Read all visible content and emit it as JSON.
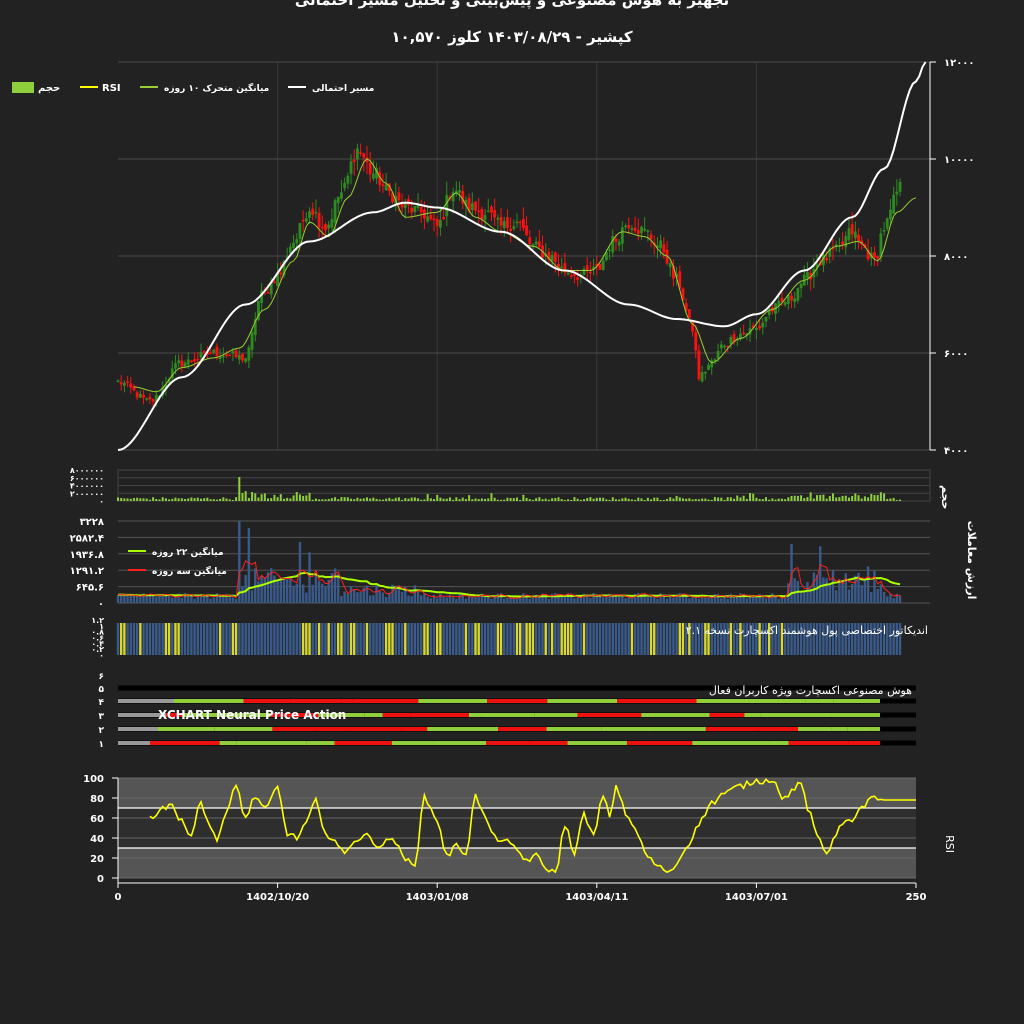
{
  "title_line1": "تجهیز به هوش مصنوعی و پیش‌بینی و تحلیل مسیر احتمالی",
  "title_line2": "کپشیر - ۱۴۰۳/۰۸/۲۹ کلوز ۱۰,۵۷۰",
  "colors": {
    "background": "#222222",
    "up": "#2e8b22",
    "down": "#ff1010",
    "ma10": "#9acd32",
    "path": "#ffffff",
    "rsi": "#ffff00",
    "volume": "#8fcf3c",
    "value_bar": "#3a5a8a",
    "ma22": "#aaff00",
    "ma3": "#ff2020"
  },
  "panels": {
    "volume_label": "حجم",
    "value_label": "ارزش معاملات",
    "value_legend": [
      "میانگین ۲۲ روزه",
      "میانگین سه روزه"
    ],
    "indicator_label": "اندیکاتور اختصاصی پول هوشمند اکسچارت نسخه ۲.۱",
    "ai_label": "هوش مصنوعی اکسچارت ویژه کاربران فعال",
    "ai_watermark": "XCHART Neural Price Action",
    "rsi_label": "RSI"
  },
  "chart_data": [
    {
      "type": "candlestick",
      "title": "کپشیر",
      "legend": [
        {
          "name": "حجم",
          "kind": "box",
          "color": "#8fcf3c"
        },
        {
          "name": "RSI",
          "kind": "line",
          "color": "#ffff00"
        },
        {
          "name": "میانگین متحرک ۱۰ روزه",
          "kind": "line",
          "color": "#9acd32"
        },
        {
          "name": "مسیر احتمالی",
          "kind": "line",
          "color": "#ffffff"
        }
      ],
      "ylim": [
        4000,
        12000
      ],
      "yticks": [
        "۴۰۰۰",
        "۶۰۰۰",
        "۸۰۰۰",
        "۱۰۰۰۰",
        "۱۲۰۰۰"
      ],
      "close_anchors": [
        [
          0,
          5400
        ],
        [
          10,
          5000
        ],
        [
          20,
          5800
        ],
        [
          30,
          6000
        ],
        [
          40,
          5900
        ],
        [
          45,
          7200
        ],
        [
          50,
          7600
        ],
        [
          55,
          8300
        ],
        [
          60,
          9000
        ],
        [
          65,
          8600
        ],
        [
          70,
          9300
        ],
        [
          75,
          10200
        ],
        [
          80,
          9700
        ],
        [
          85,
          9300
        ],
        [
          90,
          9000
        ],
        [
          95,
          8900
        ],
        [
          100,
          8600
        ],
        [
          105,
          9400
        ],
        [
          110,
          9000
        ],
        [
          115,
          8900
        ],
        [
          120,
          8600
        ],
        [
          125,
          8700
        ],
        [
          130,
          8200
        ],
        [
          135,
          8000
        ],
        [
          140,
          7700
        ],
        [
          145,
          7600
        ],
        [
          150,
          7700
        ],
        [
          155,
          8300
        ],
        [
          160,
          8700
        ],
        [
          165,
          8500
        ],
        [
          170,
          8200
        ],
        [
          175,
          7500
        ],
        [
          180,
          6500
        ],
        [
          182,
          5500
        ],
        [
          186,
          5800
        ],
        [
          190,
          6200
        ],
        [
          195,
          6400
        ],
        [
          200,
          6500
        ],
        [
          205,
          6900
        ],
        [
          210,
          7100
        ],
        [
          215,
          7500
        ],
        [
          220,
          7900
        ],
        [
          225,
          8100
        ],
        [
          230,
          8500
        ],
        [
          233,
          8200
        ],
        [
          237,
          7900
        ],
        [
          240,
          8600
        ],
        [
          245,
          9400
        ],
        [
          248,
          9800
        ],
        [
          250,
          10570
        ]
      ],
      "ma10_anchors": [
        [
          5,
          5300
        ],
        [
          12,
          5200
        ],
        [
          20,
          5700
        ],
        [
          30,
          5900
        ],
        [
          38,
          6100
        ],
        [
          46,
          6900
        ],
        [
          55,
          7900
        ],
        [
          60,
          8700
        ],
        [
          66,
          8400
        ],
        [
          72,
          9200
        ],
        [
          78,
          10000
        ],
        [
          84,
          9500
        ],
        [
          90,
          8800
        ],
        [
          100,
          8900
        ],
        [
          106,
          9300
        ],
        [
          112,
          8800
        ],
        [
          120,
          8500
        ],
        [
          130,
          8200
        ],
        [
          140,
          7700
        ],
        [
          148,
          7700
        ],
        [
          158,
          8500
        ],
        [
          165,
          8400
        ],
        [
          172,
          8000
        ],
        [
          180,
          6600
        ],
        [
          186,
          5800
        ],
        [
          195,
          6300
        ],
        [
          205,
          6900
        ],
        [
          215,
          7500
        ],
        [
          225,
          8200
        ],
        [
          232,
          8300
        ],
        [
          238,
          7900
        ],
        [
          244,
          8900
        ],
        [
          250,
          9200
        ]
      ],
      "path_anchors": [
        [
          0,
          4000
        ],
        [
          20,
          5500
        ],
        [
          40,
          7000
        ],
        [
          60,
          8300
        ],
        [
          80,
          8900
        ],
        [
          90,
          9100
        ],
        [
          100,
          9000
        ],
        [
          120,
          8500
        ],
        [
          140,
          7700
        ],
        [
          160,
          7000
        ],
        [
          175,
          6700
        ],
        [
          190,
          6550
        ],
        [
          200,
          6800
        ],
        [
          215,
          7700
        ],
        [
          230,
          8800
        ],
        [
          240,
          9800
        ],
        [
          250,
          11600
        ],
        [
          253,
          12000
        ]
      ]
    },
    {
      "type": "bar",
      "title": "حجم",
      "ylim": [
        0,
        8000000
      ],
      "yticks": [
        "۰",
        "۲۰۰۰۰۰۰",
        "۴۰۰۰۰۰۰",
        "۶۰۰۰۰۰۰",
        "۸۰۰۰۰۰۰"
      ]
    },
    {
      "type": "bar",
      "title": "ارزش معاملات",
      "ylim": [
        0,
        3228
      ],
      "yticks": [
        "۰",
        "۶۴۵.۶",
        "۱۲۹۱.۲",
        "۱۹۳۶.۸",
        "۲۵۸۲.۴",
        "۳۲۲۸"
      ],
      "series": [
        {
          "name": "میانگین ۲۲ روزه"
        },
        {
          "name": "میانگین سه روزه"
        }
      ]
    },
    {
      "type": "bar",
      "title": "اندیکاتور اختصاصی پول هوشمند اکسچارت نسخه ۲.۱",
      "ylim": [
        0,
        1.2
      ],
      "yticks": [
        "۰",
        "۰.۲",
        "۰.۴",
        "۰.۶",
        "۰.۸",
        "۱",
        "۱.۲"
      ]
    },
    {
      "type": "heatmap",
      "title": "هوش مصنوعی اکسچارت ویژه کاربران فعال",
      "rows": [
        "۱",
        "۲",
        "۳",
        "۴",
        "۵",
        "۶"
      ]
    },
    {
      "type": "line",
      "title": "RSI",
      "ylim": [
        0,
        100
      ],
      "yticks": [
        "0",
        "20",
        "40",
        "60",
        "80",
        "100"
      ],
      "upper": 70,
      "lower": 30,
      "xlim": [
        0,
        250
      ],
      "xticks": [
        {
          "x": 0,
          "label": "0"
        },
        {
          "x": 50,
          "label": "1402/10/20"
        },
        {
          "x": 100,
          "label": "1403/01/08"
        },
        {
          "x": 150,
          "label": "1403/04/11"
        },
        {
          "x": 200,
          "label": "1403/07/01"
        },
        {
          "x": 250,
          "label": "250"
        }
      ],
      "rsi_anchors": [
        [
          10,
          60
        ],
        [
          14,
          70
        ],
        [
          17,
          75
        ],
        [
          19,
          58
        ],
        [
          23,
          45
        ],
        [
          26,
          78
        ],
        [
          28,
          55
        ],
        [
          31,
          40
        ],
        [
          34,
          65
        ],
        [
          37,
          92
        ],
        [
          40,
          60
        ],
        [
          43,
          82
        ],
        [
          46,
          68
        ],
        [
          50,
          90
        ],
        [
          53,
          45
        ],
        [
          56,
          40
        ],
        [
          59,
          55
        ],
        [
          62,
          78
        ],
        [
          64,
          50
        ],
        [
          67,
          40
        ],
        [
          71,
          24
        ],
        [
          74,
          38
        ],
        [
          78,
          42
        ],
        [
          82,
          32
        ],
        [
          86,
          40
        ],
        [
          90,
          18
        ],
        [
          93,
          15
        ],
        [
          96,
          80
        ],
        [
          100,
          58
        ],
        [
          103,
          22
        ],
        [
          106,
          32
        ],
        [
          109,
          25
        ],
        [
          112,
          82
        ],
        [
          115,
          60
        ],
        [
          118,
          40
        ],
        [
          121,
          38
        ],
        [
          124,
          30
        ],
        [
          128,
          18
        ],
        [
          131,
          22
        ],
        [
          134,
          10
        ],
        [
          137,
          5
        ],
        [
          140,
          52
        ],
        [
          143,
          26
        ],
        [
          146,
          63
        ],
        [
          149,
          42
        ],
        [
          152,
          82
        ],
        [
          154,
          62
        ],
        [
          156,
          90
        ],
        [
          160,
          60
        ],
        [
          163,
          42
        ],
        [
          166,
          20
        ],
        [
          170,
          10
        ],
        [
          173,
          5
        ],
        [
          175,
          15
        ],
        [
          178,
          30
        ],
        [
          182,
          55
        ],
        [
          186,
          75
        ],
        [
          190,
          85
        ],
        [
          195,
          92
        ],
        [
          200,
          97
        ],
        [
          206,
          98
        ],
        [
          208,
          78
        ],
        [
          212,
          90
        ],
        [
          214,
          95
        ],
        [
          216,
          70
        ],
        [
          219,
          42
        ],
        [
          222,
          25
        ],
        [
          225,
          45
        ],
        [
          228,
          60
        ],
        [
          230,
          55
        ],
        [
          233,
          70
        ],
        [
          236,
          82
        ],
        [
          238,
          77
        ],
        [
          240,
          78
        ],
        [
          250,
          78
        ]
      ]
    }
  ]
}
